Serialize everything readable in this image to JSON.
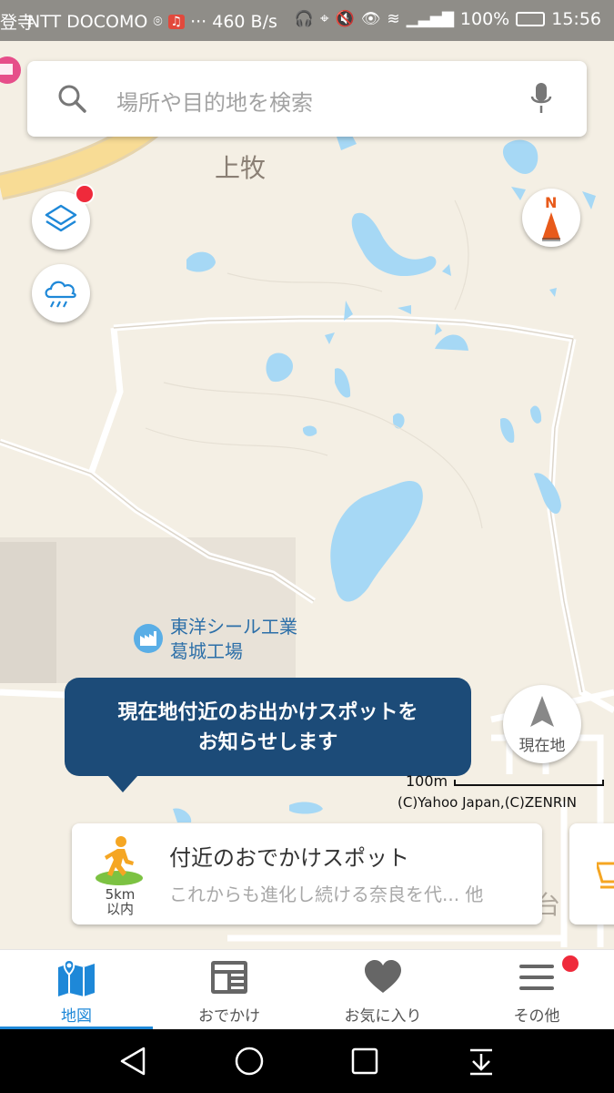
{
  "status_bar": {
    "left_text": "登寺",
    "carrier": "NTT DOCOMO",
    "speed": "··· 460 B/s",
    "battery": "100%",
    "time": "15:56"
  },
  "search": {
    "placeholder": "場所や目的地を検索"
  },
  "map": {
    "area_label": "上牧",
    "poi": {
      "name_line1": "東洋シール工業",
      "name_line2": "葛城工場"
    },
    "partial_label": "城台",
    "compass_letter": "N",
    "current_location_label": "現在地",
    "scale_label": "100m",
    "copyright": "(C)Yahoo Japan,(C)ZENRIN",
    "colors": {
      "land": "#f4efe4",
      "water": "#a6d8f5",
      "road": "#ffffff",
      "highway": "#f8dc95"
    }
  },
  "tooltip": {
    "line1": "現在地付近のお出かけスポットを",
    "line2": "お知らせします"
  },
  "spot_card": {
    "title": "付近のおでかけスポット",
    "subtitle": "これからも進化し続ける奈良を代... 他",
    "distance_line1": "5km",
    "distance_line2": "以内"
  },
  "bottom_nav": {
    "active": "map",
    "active_color": "#1e88d8",
    "items": [
      {
        "label": "地図",
        "icon": "map-icon"
      },
      {
        "label": "おでかけ",
        "icon": "news-icon"
      },
      {
        "label": "お気に入り",
        "icon": "heart-icon"
      },
      {
        "label": "その他",
        "icon": "menu-icon"
      }
    ]
  },
  "system_nav": {
    "buttons": [
      "back-icon",
      "home-icon",
      "recents-icon",
      "notification-pull-icon"
    ]
  }
}
